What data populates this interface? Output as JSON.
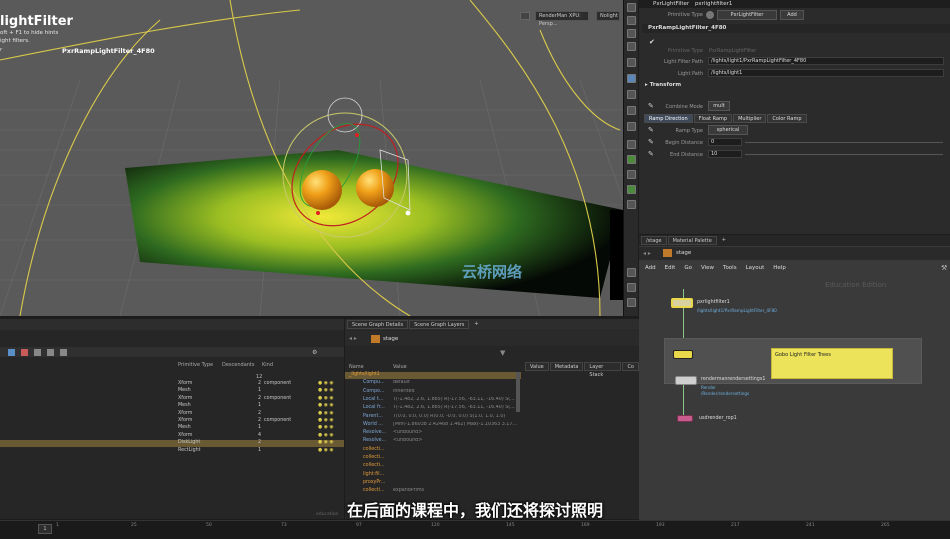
{
  "viewport": {
    "title": "lightFilter",
    "hint1": "oft + F1 to hide hints",
    "hint2": "ight filters.",
    "hint3": "r",
    "object_label": "PxrRampLightFilter_4F80",
    "renderer_button": "RenderMan XPU: Persp...",
    "display_button": "Stock",
    "settings_button": "Nolight"
  },
  "params": {
    "header_type": "PxrLightFilter",
    "header_name": "pxrlightfilter1",
    "primitive_type_label": "Primitive Type",
    "primitive_type_value": "PxrLightFilter",
    "add_button": "Add",
    "section_name": "PxrRampLightFilter_4F80",
    "primitive_type_label2": "Primitive Type",
    "primitive_type_value2": "PxrRampLightFilter",
    "filter_path_label": "Light Filter Path",
    "filter_path_value": "/lights/light1/PxrRampLightFilter_4F80",
    "light_path_label": "Light Path",
    "light_path_value": "/lights/light1",
    "transform_label": "Transform",
    "combine_label": "Combine Mode",
    "combine_value": "mult",
    "tabs": [
      "Ramp Direction",
      "Float Ramp",
      "Multiplier",
      "Color Ramp"
    ],
    "ramp_type_label": "Ramp Type",
    "ramp_type_value": "spherical",
    "begin_label": "Begin Distance",
    "begin_value": "0",
    "end_label": "End Distance",
    "end_value": "10"
  },
  "network": {
    "tabs": [
      "/stage",
      "Material Palette"
    ],
    "path": "stage",
    "menu": [
      "Add",
      "Edit",
      "Go",
      "View",
      "Tools",
      "Layout",
      "Help"
    ],
    "watermark": "Education Edition",
    "node1_name": "pxrlightfilter1",
    "node1_sub": "/lights/light1/PxrRampLightFilter_4F80",
    "sticky_note": "Gobo Light Filter Trees",
    "node2_name": "rendermanrendersettings1",
    "node2_sub1": "Render",
    "node2_sub2": "/Render/rendersettings",
    "node3_name": "usdrender_rop1"
  },
  "sheet": {
    "columns": [
      "Primitive Type",
      "Descendants",
      "Kind"
    ],
    "top_value": "12",
    "rows": [
      {
        "type": "Xform",
        "desc": "2",
        "kind": "component"
      },
      {
        "type": "Mesh",
        "desc": "1",
        "kind": ""
      },
      {
        "type": "Xform",
        "desc": "2",
        "kind": "component"
      },
      {
        "type": "Mesh",
        "desc": "1",
        "kind": ""
      },
      {
        "type": "Xform",
        "desc": "2",
        "kind": ""
      },
      {
        "type": "Xform",
        "desc": "2",
        "kind": "component"
      },
      {
        "type": "Mesh",
        "desc": "1",
        "kind": ""
      },
      {
        "type": "Xform",
        "desc": "4",
        "kind": ""
      },
      {
        "type": "DiskLight",
        "desc": "2",
        "kind": ""
      },
      {
        "type": "RectLight",
        "desc": "1",
        "kind": ""
      }
    ],
    "corner": "education"
  },
  "sgd": {
    "tabs": [
      "Scene Graph Details",
      "Scene Graph Layers"
    ],
    "path": "stage",
    "col_name": "Name",
    "col_value": "Value",
    "right_tabs": [
      "Value",
      "Metadata",
      "Layer Stack",
      "Co"
    ],
    "rows": [
      {
        "name": "_lights/light1",
        "value": ""
      },
      {
        "name": "Compu...",
        "value": "default"
      },
      {
        "name": "Compo...",
        "value": "inherited"
      },
      {
        "name": "Local t...",
        "value": "T(-1.482, 2.6, 1.865) R(-17.56, -63.11, -16.40) S(..."
      },
      {
        "name": "Local fr...",
        "value": "T(-1.482, 2.6, 1.865) R(-17.56, -63.11, -16.40) S(..."
      },
      {
        "name": "Parent...",
        "value": "T(0.0, 0.0, 0.0) R(0.0, -0.0, 0.0) S(1.0, 1.0, 1.0)"
      },
      {
        "name": "World ...",
        "value": "[Min(-1.86038 2.42468 1.462) Max(-1.10363 3.17..."
      },
      {
        "name": "Resolve...",
        "value": "<unbound>"
      },
      {
        "name": "Resolve...",
        "value": "<unbound>"
      },
      {
        "name": "collecti...",
        "value": ""
      },
      {
        "name": "collecti...",
        "value": ""
      },
      {
        "name": "collecti...",
        "value": ""
      },
      {
        "name": "light:fil...",
        "value": ""
      },
      {
        "name": "proxyPr...",
        "value": ""
      },
      {
        "name": "collecti...",
        "value": "expandPrims"
      }
    ]
  },
  "timeline": {
    "frame": "1",
    "ticks": [
      "1",
      "25",
      "50",
      "73",
      "97",
      "120",
      "145",
      "169",
      "193",
      "217",
      "241",
      "265"
    ]
  },
  "subtitle": "在后面的课程中，我们还将探讨照明",
  "watermark_logo": "云桥网络",
  "colors": {
    "accent": "#e6d34a",
    "selection": "#6a5a33",
    "node_sel": "#f2e35a"
  }
}
